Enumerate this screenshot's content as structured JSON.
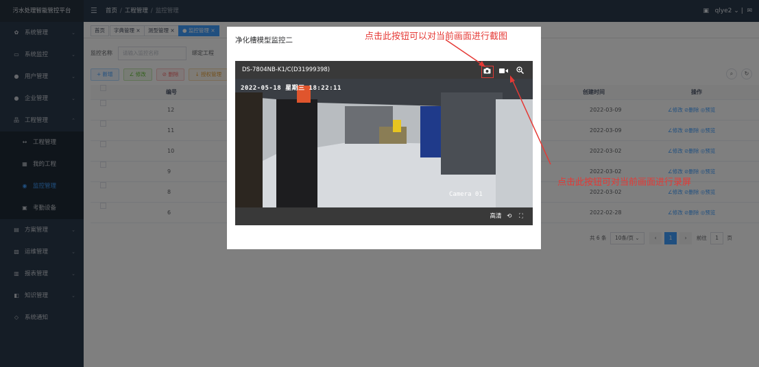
{
  "sidebar": {
    "title": "污水处理智能管控平台",
    "items": [
      {
        "label": "系统管理",
        "icon": "gear-icon"
      },
      {
        "label": "系统监控",
        "icon": "monitor-icon"
      },
      {
        "label": "用户管理",
        "icon": "user-icon"
      },
      {
        "label": "企业管理",
        "icon": "user-icon"
      },
      {
        "label": "工程管理",
        "icon": "project-icon"
      }
    ],
    "subitems": [
      {
        "label": "工程管理",
        "icon": "link-icon"
      },
      {
        "label": "我的工程",
        "icon": "list-icon"
      },
      {
        "label": "监控管理",
        "icon": "eye-icon"
      },
      {
        "label": "考勤设备",
        "icon": "device-icon"
      }
    ],
    "items2": [
      {
        "label": "方案管理",
        "icon": "doc-icon"
      },
      {
        "label": "运维管理",
        "icon": "wrench-icon"
      },
      {
        "label": "报表管理",
        "icon": "chart-icon"
      },
      {
        "label": "知识管理",
        "icon": "book-icon"
      },
      {
        "label": "系统通知",
        "icon": "bell-icon"
      }
    ]
  },
  "topbar": {
    "breadcrumb": [
      "首页",
      "工程管理",
      "监控管理"
    ],
    "username": "qlye2"
  },
  "tags": [
    "首页",
    "字典管理",
    "测型管理",
    "监控管理"
  ],
  "search": {
    "label1": "监控名称",
    "placeholder": "请输入监控名称",
    "label2": "绑定工程"
  },
  "buttons": {
    "add": "+ 新增",
    "edit": "∠ 修改",
    "delete": "⊘ 删除",
    "export": "↓ 授权管理"
  },
  "table": {
    "headers": {
      "num": "编号",
      "created": "创建时间",
      "ops": "操作"
    },
    "rows": [
      {
        "num": "12",
        "created": "2022-03-09"
      },
      {
        "num": "11",
        "created": "2022-03-09"
      },
      {
        "num": "10",
        "created": "2022-03-02"
      },
      {
        "num": "9",
        "created": "2022-03-02"
      },
      {
        "num": "8",
        "created": "2022-03-02"
      },
      {
        "num": "6",
        "created": "2022-02-28"
      }
    ],
    "ops": "∠修改 ⊘删除 ◎预览"
  },
  "pager": {
    "total": "共 6 条",
    "size": "10条/页",
    "page": "1",
    "goto": "前往",
    "goto_val": "1",
    "unit": "页"
  },
  "modal": {
    "title": "净化槽模型监控二",
    "device": "DS-7804NB-K1/C(D31999398)",
    "osd_time": "2022-05-18 星期三 18:22:11",
    "camera": "Camera 01",
    "quality": "高清"
  },
  "annotations": {
    "snapshot": "点击此按钮可以对当前画面进行截图",
    "record": "点击此按钮可对当前画面进行录屏"
  },
  "colors": {
    "sidebar": "#2b3a4d",
    "accent": "#409eff",
    "annotation": "#e53935"
  }
}
